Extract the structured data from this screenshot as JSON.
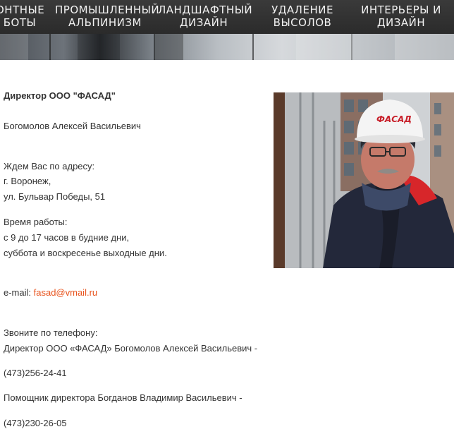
{
  "nav": {
    "items": [
      {
        "line1": "онтные",
        "line2": "боты"
      },
      {
        "line1": "Промышленный",
        "line2": "альпинизм"
      },
      {
        "line1": "Ландшафтный",
        "line2": "дизайн"
      },
      {
        "line1": "Удаление",
        "line2": "высолов"
      },
      {
        "line1": "Интерьеры и",
        "line2": "дизайн"
      }
    ]
  },
  "contact": {
    "heading": "Директор ООО \"ФАСАД\"",
    "director_name": "Богомолов Алексей Васильевич",
    "address_label": "Ждем Вас по адресу:",
    "city": "г. Воронеж,",
    "street": "ул. Бульвар Победы, 51",
    "hours_label": "Время работы:",
    "hours_weekdays": "с 9 до 17 часов в будние дни,",
    "hours_weekend": "суббота и воскресенье выходные дни.",
    "email_label": "e-mail: ",
    "email": "fasad@vmail.ru",
    "phone_label": "Звоните по телефону:",
    "director_line": "Директор ООО «ФАСАД» Богомолов Алексей Васильевич -",
    "director_phone": "(473)256-24-41",
    "assistant_line": "Помощник директора Богданов Владимир Васильевич -",
    "assistant_phone": "(473)230-26-05"
  },
  "photo": {
    "helmet_text": "ФАСАД"
  },
  "colors": {
    "nav_bg": "#333333",
    "nav_text": "#f2f2f2",
    "link": "#e8541e",
    "text": "#333333"
  }
}
